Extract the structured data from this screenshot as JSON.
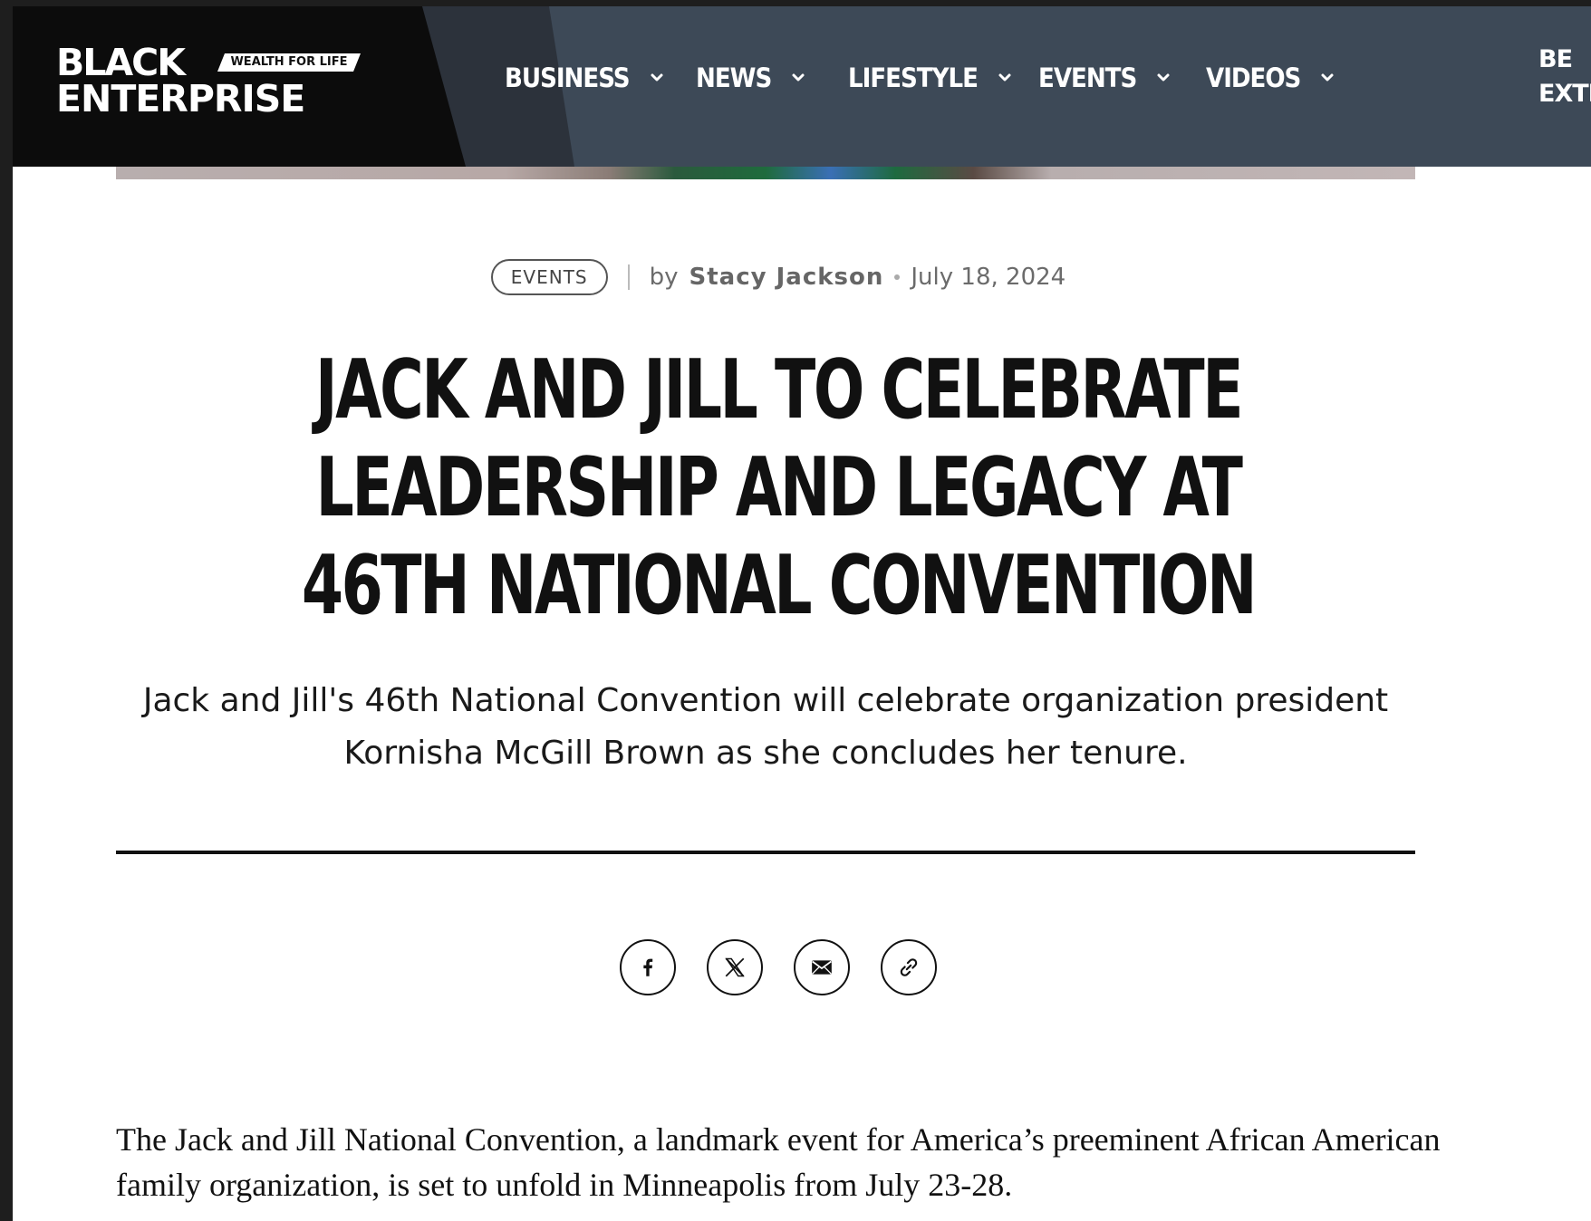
{
  "header": {
    "logo": {
      "line1": "BLACK",
      "tagline": "WEALTH FOR LIFE",
      "line2": "ENTERPRISE"
    },
    "nav": [
      {
        "label": "BUSINESS",
        "icon": "chevron-down-icon"
      },
      {
        "label": "NEWS",
        "icon": "chevron-down-icon"
      },
      {
        "label": "LIFESTYLE",
        "icon": "chevron-down-icon"
      },
      {
        "label": "EVENTS",
        "icon": "chevron-down-icon"
      },
      {
        "label": "VIDEOS",
        "icon": "chevron-down-icon"
      }
    ],
    "nav_extra": {
      "line1": "BE",
      "line2": "EXTR"
    },
    "colors": {
      "bar": "#3d4957",
      "logo_bg": "#0c0c0c",
      "text": "#ffffff"
    }
  },
  "article": {
    "category": "EVENTS",
    "by_label": "by",
    "author": "Stacy Jackson",
    "date": "July 18, 2024",
    "title": "JACK AND JILL TO CELEBRATE LEADERSHIP AND LEGACY AT 46TH NATIONAL CONVENTION",
    "dek": "Jack and Jill's 46th National Convention will celebrate organization president Kornisha McGill Brown as she concludes her tenure.",
    "share": [
      "facebook-icon",
      "x-icon",
      "email-icon",
      "link-icon"
    ],
    "body_first_paragraph": "The Jack and Jill National Convention, a landmark event for America’s preeminent African American family organization, is set to unfold in Minneapolis from July 23-28."
  }
}
